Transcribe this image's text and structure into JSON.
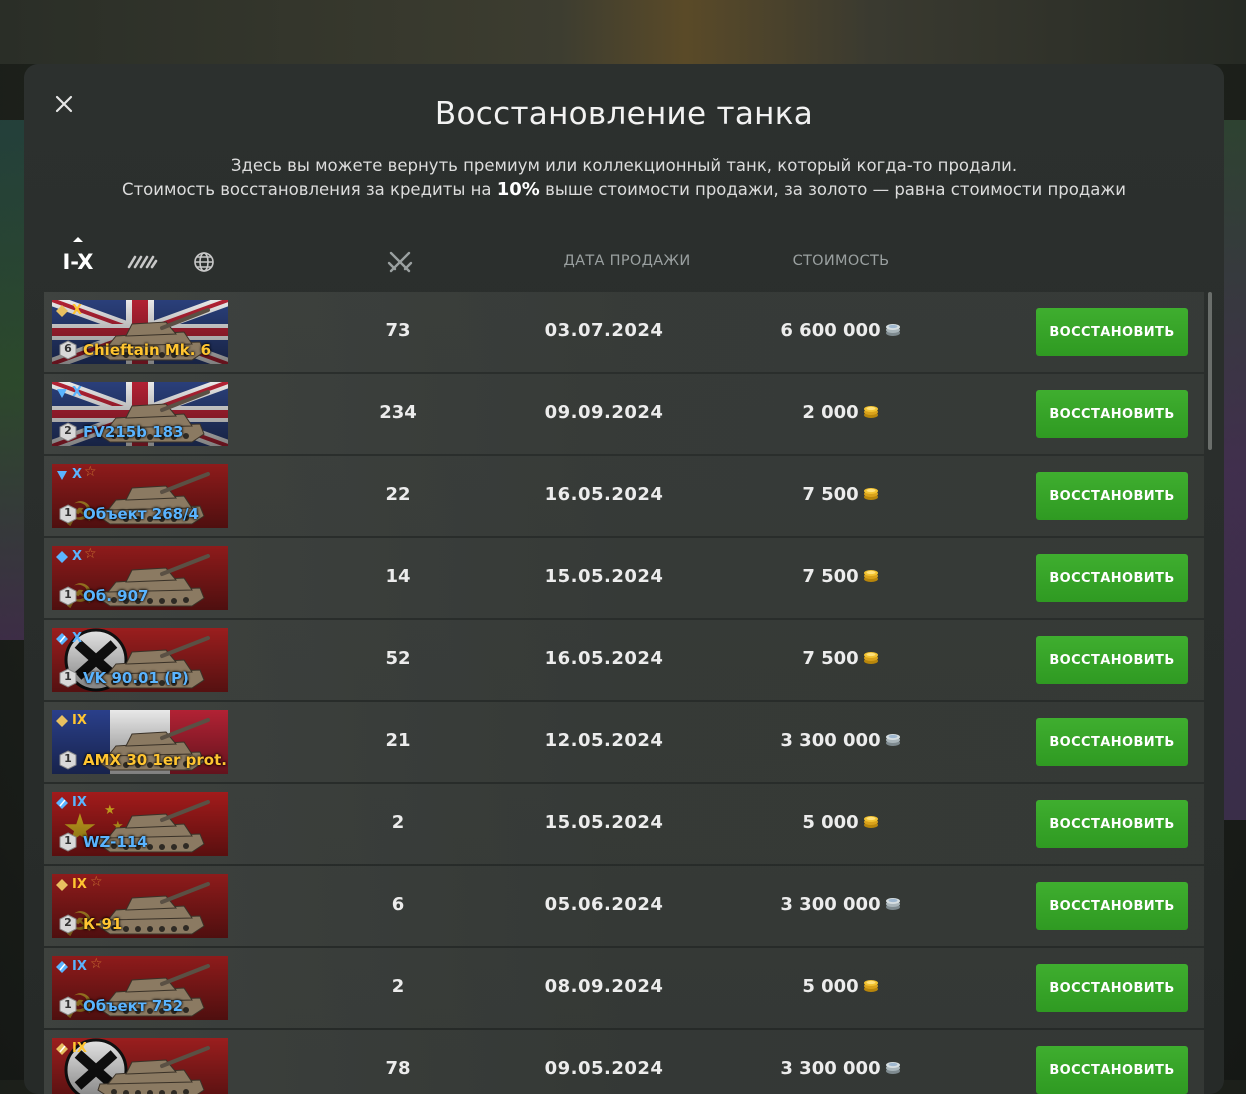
{
  "modal": {
    "title": "Восстановление танка",
    "subtitle_line1": "Здесь вы можете вернуть премиум или коллекционный танк, который когда-то продали.",
    "subtitle_line2_before": "Стоимость восстановления за кредиты на ",
    "subtitle_line2_percent": "10%",
    "subtitle_line2_after": " выше стоимости продажи, за золото — равна стоимости продажи"
  },
  "header": {
    "tier_filter_label": "I-X",
    "date_column": "ДАТА ПРОДАЖИ",
    "cost_column": "СТОИМОСТЬ"
  },
  "colors": {
    "collector_name": "#ffc531",
    "premium_name": "#5ab4ff",
    "button_green": "#38a62a",
    "silver": "#c9d3d6",
    "gold": "#f2b824"
  },
  "rows": [
    {
      "tier": "X",
      "name": "Chieftain Mk. 6",
      "name_type": "collector",
      "type_icon": "medium-tank-icon",
      "mastery": "6",
      "flag": "uk",
      "star": false,
      "battles": "73",
      "date": "03.07.2024",
      "cost": "6 600 000",
      "currency": "silver",
      "button": "ВОССТАНОВИТЬ"
    },
    {
      "tier": "X",
      "name": "FV215b 183",
      "name_type": "premium",
      "type_icon": "tank-destroyer-icon",
      "mastery": "2",
      "flag": "uk",
      "star": false,
      "battles": "234",
      "date": "09.09.2024",
      "cost": "2 000",
      "currency": "gold",
      "button": "ВОССТАНОВИТЬ"
    },
    {
      "tier": "X",
      "name": "Объект 268/4",
      "name_type": "premium",
      "type_icon": "tank-destroyer-icon",
      "mastery": "1",
      "flag": "ussr",
      "star": true,
      "battles": "22",
      "date": "16.05.2024",
      "cost": "7 500",
      "currency": "gold",
      "button": "ВОССТАНОВИТЬ"
    },
    {
      "tier": "X",
      "name": "Об. 907",
      "name_type": "premium",
      "type_icon": "medium-tank-icon",
      "mastery": "1",
      "flag": "ussr",
      "star": true,
      "battles": "14",
      "date": "15.05.2024",
      "cost": "7 500",
      "currency": "gold",
      "button": "ВОССТАНОВИТЬ"
    },
    {
      "tier": "X",
      "name": "VK 90.01 (P)",
      "name_type": "premium",
      "type_icon": "heavy-tank-icon",
      "mastery": "1",
      "flag": "germany",
      "star": false,
      "battles": "52",
      "date": "16.05.2024",
      "cost": "7 500",
      "currency": "gold",
      "button": "ВОССТАНОВИТЬ"
    },
    {
      "tier": "IX",
      "name": "AMX 30 1er prot.",
      "name_type": "collector",
      "type_icon": "medium-tank-icon",
      "mastery": "1",
      "flag": "france",
      "star": false,
      "battles": "21",
      "date": "12.05.2024",
      "cost": "3 300 000",
      "currency": "silver",
      "button": "ВОССТАНОВИТЬ"
    },
    {
      "tier": "IX",
      "name": "WZ-114",
      "name_type": "premium",
      "type_icon": "heavy-tank-icon",
      "mastery": "1",
      "flag": "china",
      "star": false,
      "battles": "2",
      "date": "15.05.2024",
      "cost": "5 000",
      "currency": "gold",
      "button": "ВОССТАНОВИТЬ"
    },
    {
      "tier": "IX",
      "name": "К-91",
      "name_type": "collector",
      "type_icon": "medium-tank-icon",
      "mastery": "2",
      "flag": "ussr",
      "star": true,
      "battles": "6",
      "date": "05.06.2024",
      "cost": "3 300 000",
      "currency": "silver",
      "button": "ВОССТАНОВИТЬ"
    },
    {
      "tier": "IX",
      "name": "Объект 752",
      "name_type": "premium",
      "type_icon": "heavy-tank-icon",
      "mastery": "1",
      "flag": "ussr",
      "star": true,
      "battles": "2",
      "date": "08.09.2024",
      "cost": "5 000",
      "currency": "gold",
      "button": "ВОССТАНОВИТЬ"
    },
    {
      "tier": "IX",
      "name": "",
      "name_type": "collector",
      "type_icon": "heavy-tank-icon",
      "mastery": "",
      "flag": "germany",
      "star": false,
      "battles": "78",
      "date": "09.05.2024",
      "cost": "3 300 000",
      "currency": "silver",
      "button": "ВОССТАНОВИТЬ"
    }
  ]
}
